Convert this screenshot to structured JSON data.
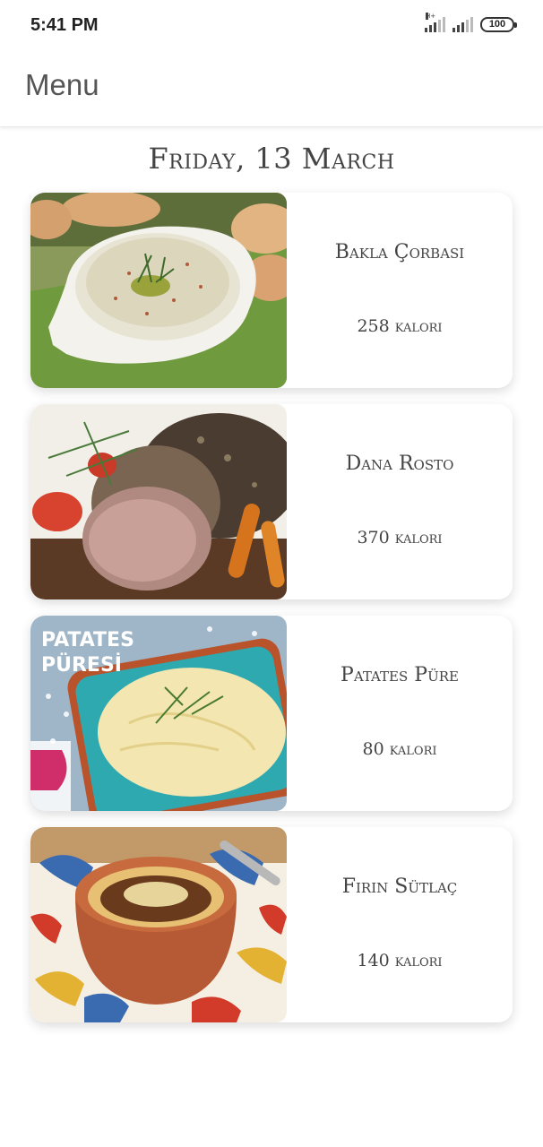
{
  "status_bar": {
    "time": "5:41 PM",
    "battery": "100",
    "network_tag": "H+",
    "colors": {
      "icons": "#444444"
    }
  },
  "app_bar": {
    "title": "Menu"
  },
  "date_heading": "Friday, 13 March",
  "menu": [
    {
      "name": "Bakla Çorbası",
      "calories": "258 kalori",
      "photo": "bean-soup-photo"
    },
    {
      "name": "Dana Rosto",
      "calories": "370 kalori",
      "photo": "roast-beef-photo"
    },
    {
      "name": "Patates Püre",
      "calories": "80 kalori",
      "photo": "mashed-potato-photo",
      "photo_caption": [
        "PATATES",
        "PÜRESİ"
      ]
    },
    {
      "name": "Fırın Sütlaç",
      "calories": "140 kalori",
      "photo": "rice-pudding-photo"
    }
  ]
}
